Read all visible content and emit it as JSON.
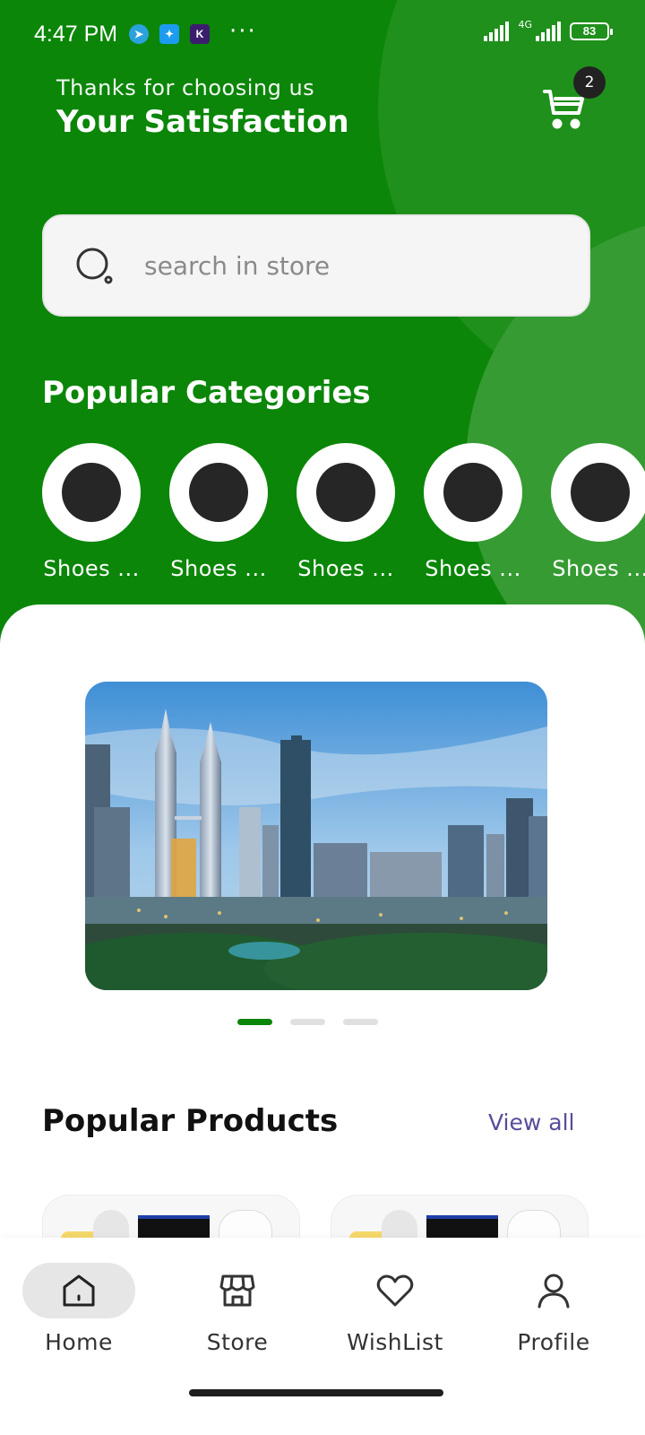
{
  "status_bar": {
    "time": "4:47 PM",
    "more_dots": "···",
    "network": "4G",
    "battery": "83",
    "app_icons": [
      "telegram-icon",
      "twitter-icon",
      "k-app-icon"
    ]
  },
  "header": {
    "subtitle": "Thanks for choosing us",
    "title": "Your Satisfaction",
    "cart_count": "2"
  },
  "search": {
    "placeholder": "search in store",
    "value": ""
  },
  "categories": {
    "title": "Popular Categories",
    "items": [
      {
        "label": "Shoes ..."
      },
      {
        "label": "Shoes ..."
      },
      {
        "label": "Shoes ..."
      },
      {
        "label": "Shoes ..."
      },
      {
        "label": "Shoes ..."
      }
    ]
  },
  "carousel": {
    "slides": 3,
    "active_index": 0
  },
  "products": {
    "title": "Popular Products",
    "view_all": "View all"
  },
  "bottom_nav": {
    "items": [
      {
        "label": "Home",
        "icon": "home-icon",
        "active": true
      },
      {
        "label": "Store",
        "icon": "store-icon",
        "active": false
      },
      {
        "label": "WishList",
        "icon": "heart-icon",
        "active": false
      },
      {
        "label": "Profile",
        "icon": "user-icon",
        "active": false
      }
    ]
  },
  "colors": {
    "primary": "#0b8608",
    "link": "#5a4b9c",
    "badge": "#222222"
  }
}
